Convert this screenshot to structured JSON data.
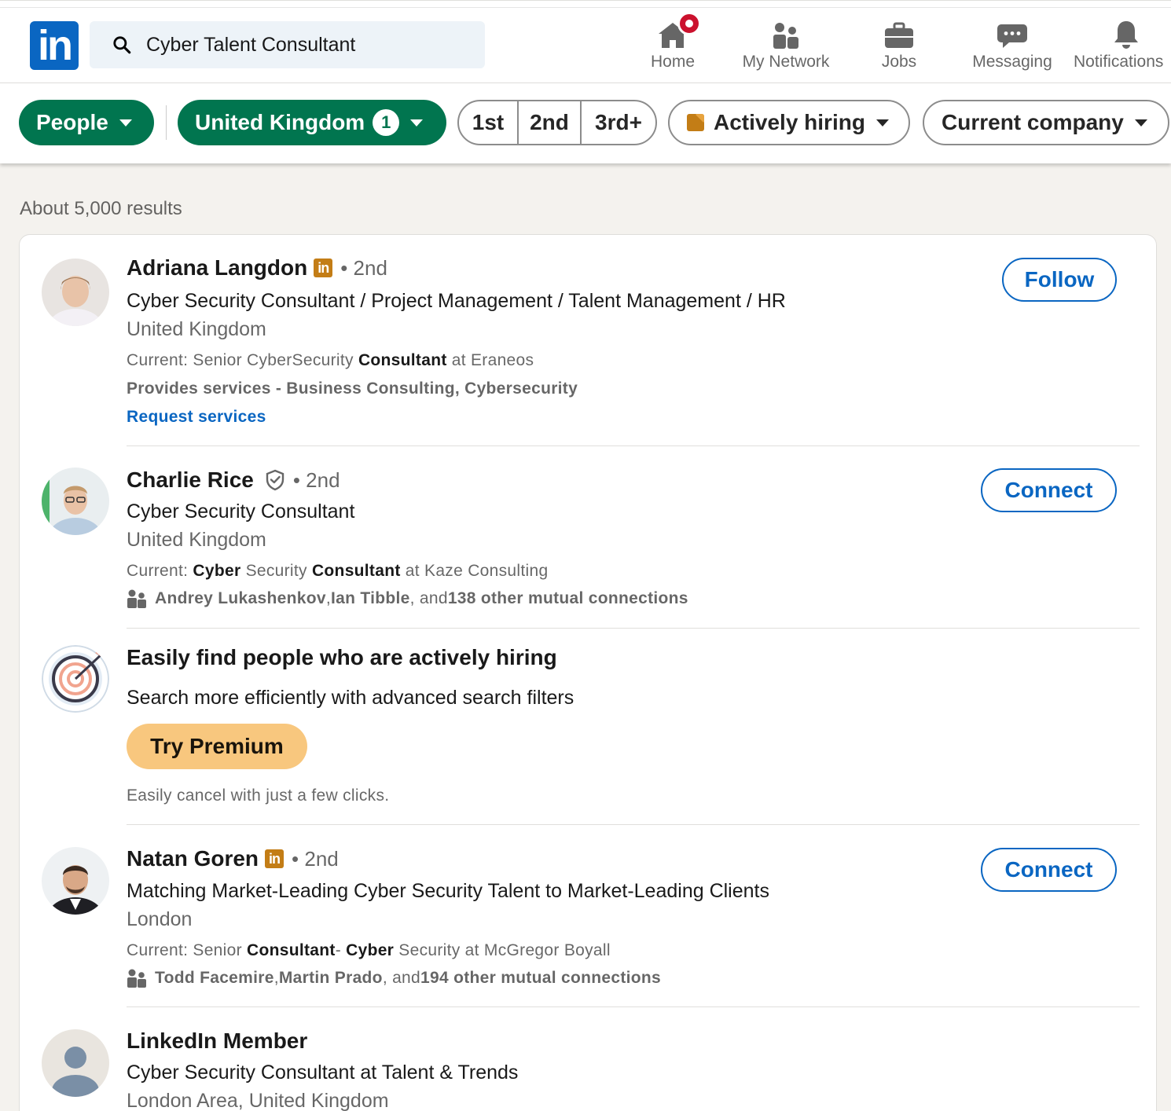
{
  "header": {
    "logo_text": "in",
    "search_value": "Cyber Talent Consultant",
    "nav": [
      {
        "label": "Home",
        "icon": "home-icon"
      },
      {
        "label": "My Network",
        "icon": "network-icon"
      },
      {
        "label": "Jobs",
        "icon": "briefcase-icon"
      },
      {
        "label": "Messaging",
        "icon": "chat-icon"
      },
      {
        "label": "Notifications",
        "icon": "bell-icon"
      }
    ],
    "colors": {
      "brand": "#0a66c2",
      "notification_badge": "#cb112d"
    }
  },
  "filters": {
    "people": "People",
    "location": "United Kingdom",
    "location_count": "1",
    "degrees": [
      "1st",
      "2nd",
      "3rd+"
    ],
    "actively_hiring": "Actively hiring",
    "current_company": "Current company",
    "colors": {
      "active_filter": "#01754f"
    }
  },
  "results_count": "About 5,000 results",
  "results": [
    {
      "name": "Adriana Langdon",
      "badge": "in",
      "degree": "• 2nd",
      "headline": "Cyber Security Consultant / Project Management / Talent Management / HR",
      "location": "United Kingdom",
      "current_prefix": "Current: Senior CyberSecurity ",
      "current_bold": "Consultant",
      "current_suffix": " at Eraneos",
      "services": "Provides services - Business Consulting, Cybersecurity",
      "link": "Request services",
      "action": "Follow"
    },
    {
      "name": "Charlie Rice",
      "degree": "• 2nd",
      "headline": "Cyber Security Consultant",
      "location": "United Kingdom",
      "current_prefix": "Current: ",
      "current_bold1": "Cyber",
      "current_mid": " Security ",
      "current_bold2": "Consultant",
      "current_suffix": " at Kaze Consulting",
      "mutual_names": "Andrey Lukashenkov",
      "mutual_sep": ", ",
      "mutual_names2": "Ian Tibble",
      "mutual_and": ", and ",
      "mutual_count": "138 other mutual connections",
      "action": "Connect"
    },
    {
      "name": "Natan Goren",
      "badge": "in",
      "degree": "• 2nd",
      "headline": "Matching Market-Leading Cyber Security Talent to Market-Leading Clients",
      "location": "London",
      "current_prefix": "Current: Senior ",
      "current_bold1": "Consultant",
      "current_mid": "- ",
      "current_bold2": "Cyber",
      "current_suffix": " Security at McGregor Boyall",
      "mutual_names": "Todd Facemire",
      "mutual_sep": ", ",
      "mutual_names2": "Martin Prado",
      "mutual_and": ", and ",
      "mutual_count": "194 other mutual connections",
      "action": "Connect"
    },
    {
      "name": "LinkedIn Member",
      "headline": "Cyber Security Consultant at Talent & Trends",
      "location": "London Area, United Kingdom"
    }
  ],
  "promo": {
    "title": "Easily find people who are actively hiring",
    "subtitle": "Search more efficiently with advanced search filters",
    "button": "Try Premium",
    "note": "Easily cancel with just a few clicks.",
    "colors": {
      "premium_button": "#f8c77e"
    }
  }
}
